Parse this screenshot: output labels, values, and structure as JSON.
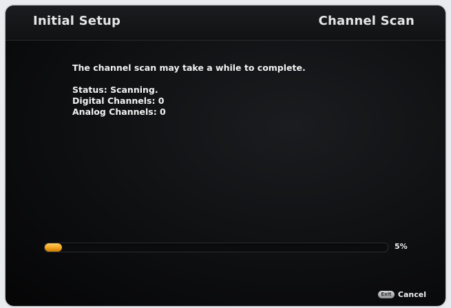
{
  "header": {
    "title": "Initial Setup",
    "section": "Channel Scan"
  },
  "content": {
    "message": "The channel scan may take a while to complete.",
    "status": "Status: Scanning.",
    "digital_channels": "Digital Channels: 0",
    "analog_channels": "Analog Channels: 0"
  },
  "progress": {
    "value": 0.05,
    "label": "5%",
    "fill_color": "#f0a21c"
  },
  "footer": {
    "exit_key_label": "Exit",
    "cancel_label": "Cancel"
  }
}
